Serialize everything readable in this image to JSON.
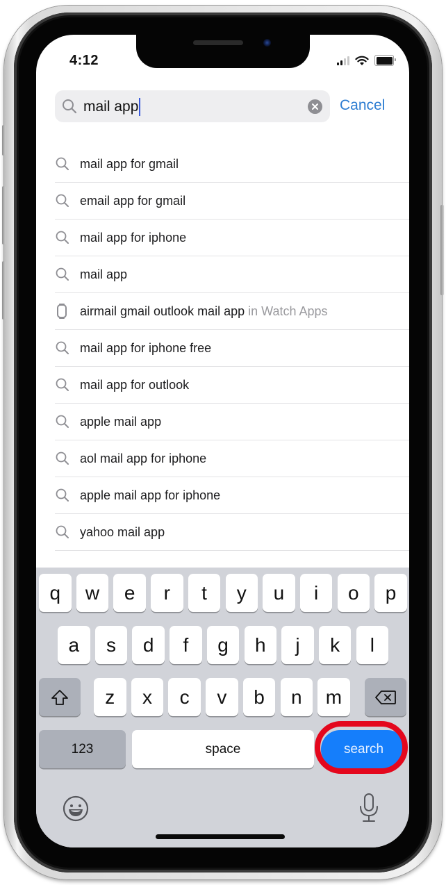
{
  "status_bar": {
    "time": "4:12",
    "signal_bars": 2,
    "signal_bars_total": 4,
    "wifi": "wifi-icon",
    "battery": "battery-icon"
  },
  "search": {
    "query": "mail app",
    "clear_icon": "clear-icon",
    "cancel_label": "Cancel",
    "accent_color": "#2d7dd2"
  },
  "suggestions": [
    {
      "text": "mail app for gmail",
      "scope": "",
      "icon": "search-icon"
    },
    {
      "text": "email app for gmail",
      "scope": "",
      "icon": "search-icon"
    },
    {
      "text": "mail app for iphone",
      "scope": "",
      "icon": "search-icon"
    },
    {
      "text": "mail app",
      "scope": "",
      "icon": "search-icon"
    },
    {
      "text": "airmail gmail outlook mail app",
      "scope": " in Watch Apps",
      "icon": "watch-icon"
    },
    {
      "text": "mail app for iphone free",
      "scope": "",
      "icon": "search-icon"
    },
    {
      "text": "mail app for outlook",
      "scope": "",
      "icon": "search-icon"
    },
    {
      "text": "apple mail app",
      "scope": "",
      "icon": "search-icon"
    },
    {
      "text": "aol mail app for iphone",
      "scope": "",
      "icon": "search-icon"
    },
    {
      "text": "apple mail app for iphone",
      "scope": "",
      "icon": "search-icon"
    },
    {
      "text": "yahoo mail app",
      "scope": "",
      "icon": "search-icon"
    }
  ],
  "keyboard": {
    "row1": [
      "q",
      "w",
      "e",
      "r",
      "t",
      "y",
      "u",
      "i",
      "o",
      "p"
    ],
    "row2": [
      "a",
      "s",
      "d",
      "f",
      "g",
      "h",
      "j",
      "k",
      "l"
    ],
    "row3": [
      "z",
      "x",
      "c",
      "v",
      "b",
      "n",
      "m"
    ],
    "shift_icon": "shift-icon",
    "delete_icon": "delete-icon",
    "numbers_label": "123",
    "space_label": "space",
    "search_label": "search",
    "search_key_color": "#157efb",
    "highlight_color": "#e4071d",
    "emoji_icon": "emoji-icon",
    "dictation_icon": "microphone-icon"
  }
}
